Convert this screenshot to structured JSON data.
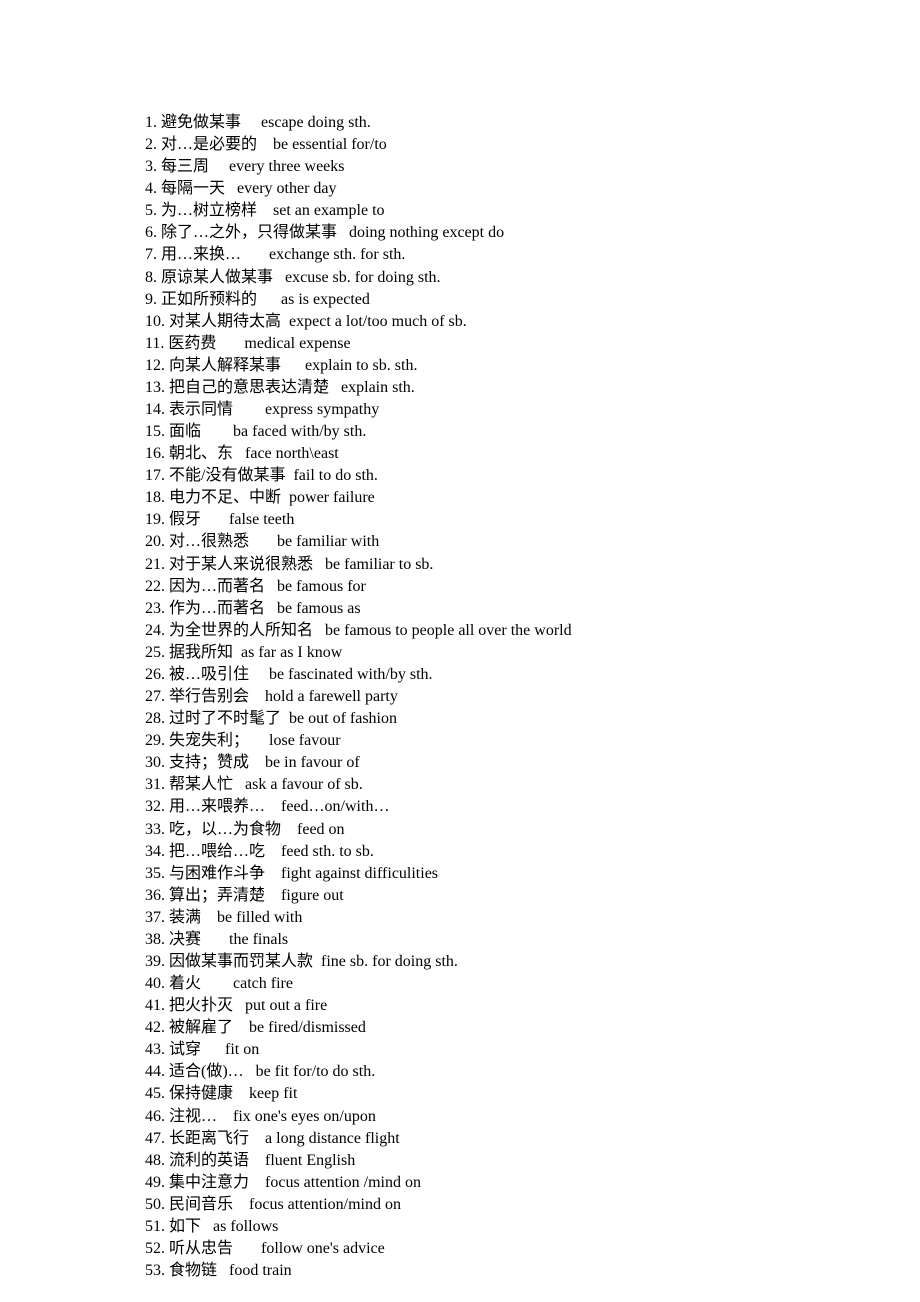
{
  "entries": [
    {
      "num": "1.",
      "cn": "避免做某事",
      "gap": "     ",
      "en": "escape doing sth."
    },
    {
      "num": "2.",
      "cn": "对…是必要的",
      "gap": "    ",
      "en": "be essential for/to"
    },
    {
      "num": "3.",
      "cn": "每三周",
      "gap": "     ",
      "en": "every three weeks"
    },
    {
      "num": "4.",
      "cn": "每隔一天",
      "gap": "   ",
      "en": "every other day"
    },
    {
      "num": "5.",
      "cn": "为…树立榜样",
      "gap": "    ",
      "en": "set an example to"
    },
    {
      "num": "6.",
      "cn": "除了…之外，只得做某事",
      "gap": "   ",
      "en": "doing nothing except do"
    },
    {
      "num": "7.",
      "cn": "用…来换…",
      "gap": "       ",
      "en": "exchange sth. for sth."
    },
    {
      "num": "8.",
      "cn": "原谅某人做某事",
      "gap": "   ",
      "en": "excuse sb. for doing sth."
    },
    {
      "num": "9.",
      "cn": "正如所预料的",
      "gap": "      ",
      "en": "as is expected"
    },
    {
      "num": "10.",
      "cn": "对某人期待太高",
      "gap": "  ",
      "en": "expect a lot/too much of sb."
    },
    {
      "num": "11.",
      "cn": "医药费",
      "gap": "       ",
      "en": "medical expense"
    },
    {
      "num": "12.",
      "cn": "向某人解释某事",
      "gap": "      ",
      "en": "explain to sb. sth."
    },
    {
      "num": "13.",
      "cn": "把自己的意思表达清楚",
      "gap": "   ",
      "en": "explain sth."
    },
    {
      "num": "14.",
      "cn": "表示同情",
      "gap": "        ",
      "en": "express sympathy"
    },
    {
      "num": "15.",
      "cn": "面临",
      "gap": "        ",
      "en": "ba faced with/by sth."
    },
    {
      "num": "16.",
      "cn": "朝北、东",
      "gap": "   ",
      "en": "face north\\east"
    },
    {
      "num": "17.",
      "cn": "不能/没有做某事",
      "gap": "  ",
      "en": "fail to do sth."
    },
    {
      "num": "18.",
      "cn": "电力不足、中断",
      "gap": "  ",
      "en": "power failure"
    },
    {
      "num": "19.",
      "cn": "假牙",
      "gap": "       ",
      "en": "false teeth"
    },
    {
      "num": "20.",
      "cn": "对…很熟悉",
      "gap": "       ",
      "en": "be familiar with"
    },
    {
      "num": "21.",
      "cn": "对于某人来说很熟悉",
      "gap": "   ",
      "en": "be familiar to sb."
    },
    {
      "num": "22.",
      "cn": "因为…而著名",
      "gap": "   ",
      "en": "be famous for"
    },
    {
      "num": "23.",
      "cn": "作为…而著名",
      "gap": "   ",
      "en": "be famous as"
    },
    {
      "num": "24.",
      "cn": "为全世界的人所知名",
      "gap": "   ",
      "en": "be famous to people all over the world"
    },
    {
      "num": "25.",
      "cn": "据我所知",
      "gap": "  ",
      "en": "as far as I know"
    },
    {
      "num": "26.",
      "cn": "被…吸引住",
      "gap": "     ",
      "en": "be fascinated with/by sth."
    },
    {
      "num": "27.",
      "cn": "举行告别会",
      "gap": "    ",
      "en": "hold a farewell party"
    },
    {
      "num": "28.",
      "cn": "过时了不时髦了",
      "gap": "  ",
      "en": "be out of fashion"
    },
    {
      "num": "29.",
      "cn": "失宠失利；",
      "gap": "     ",
      "en": "lose favour"
    },
    {
      "num": "30.",
      "cn": "支持；赞成",
      "gap": "    ",
      "en": "be in favour of"
    },
    {
      "num": "31.",
      "cn": "帮某人忙",
      "gap": "   ",
      "en": "ask a favour of sb."
    },
    {
      "num": "32.",
      "cn": "用…来喂养…",
      "gap": "    ",
      "en": "feed…on/with…"
    },
    {
      "num": "33.",
      "cn": "吃，以…为食物",
      "gap": "    ",
      "en": "feed on"
    },
    {
      "num": "34.",
      "cn": "把…喂给…吃",
      "gap": "    ",
      "en": "feed sth. to sb."
    },
    {
      "num": "35.",
      "cn": "与困难作斗争",
      "gap": "    ",
      "en": "fight against difficulities"
    },
    {
      "num": "36.",
      "cn": "算出；弄清楚",
      "gap": "    ",
      "en": "figure out"
    },
    {
      "num": "37.",
      "cn": "装满",
      "gap": "    ",
      "en": "be filled with"
    },
    {
      "num": "38.",
      "cn": "决赛",
      "gap": "       ",
      "en": "the finals"
    },
    {
      "num": "39.",
      "cn": "因做某事而罚某人款",
      "gap": "  ",
      "en": "fine sb. for doing sth."
    },
    {
      "num": "40.",
      "cn": "着火",
      "gap": "        ",
      "en": "catch fire"
    },
    {
      "num": "41.",
      "cn": "把火扑灭",
      "gap": "   ",
      "en": "put out a fire"
    },
    {
      "num": "42.",
      "cn": "被解雇了",
      "gap": "    ",
      "en": "be fired/dismissed"
    },
    {
      "num": "43.",
      "cn": "试穿",
      "gap": "      ",
      "en": "fit on"
    },
    {
      "num": "44.",
      "cn": "适合(做)…",
      "gap": "   ",
      "en": "be fit for/to do sth."
    },
    {
      "num": "45.",
      "cn": "保持健康",
      "gap": "    ",
      "en": "keep fit"
    },
    {
      "num": "46.",
      "cn": "注视…",
      "gap": "    ",
      "en": "fix one's eyes on/upon"
    },
    {
      "num": "47.",
      "cn": "长距离飞行",
      "gap": "    ",
      "en": "a long distance flight"
    },
    {
      "num": "48.",
      "cn": "流利的英语",
      "gap": "    ",
      "en": "fluent English"
    },
    {
      "num": "49.",
      "cn": "集中注意力",
      "gap": "    ",
      "en": "focus attention /mind on"
    },
    {
      "num": "50.",
      "cn": "民间音乐",
      "gap": "    ",
      "en": "focus attention/mind on"
    },
    {
      "num": "51.",
      "cn": "如下",
      "gap": "   ",
      "en": "as follows"
    },
    {
      "num": "52.",
      "cn": "听从忠告",
      "gap": "       ",
      "en": "follow one's advice"
    },
    {
      "num": "53.",
      "cn": "食物链",
      "gap": "   ",
      "en": "food train"
    }
  ]
}
